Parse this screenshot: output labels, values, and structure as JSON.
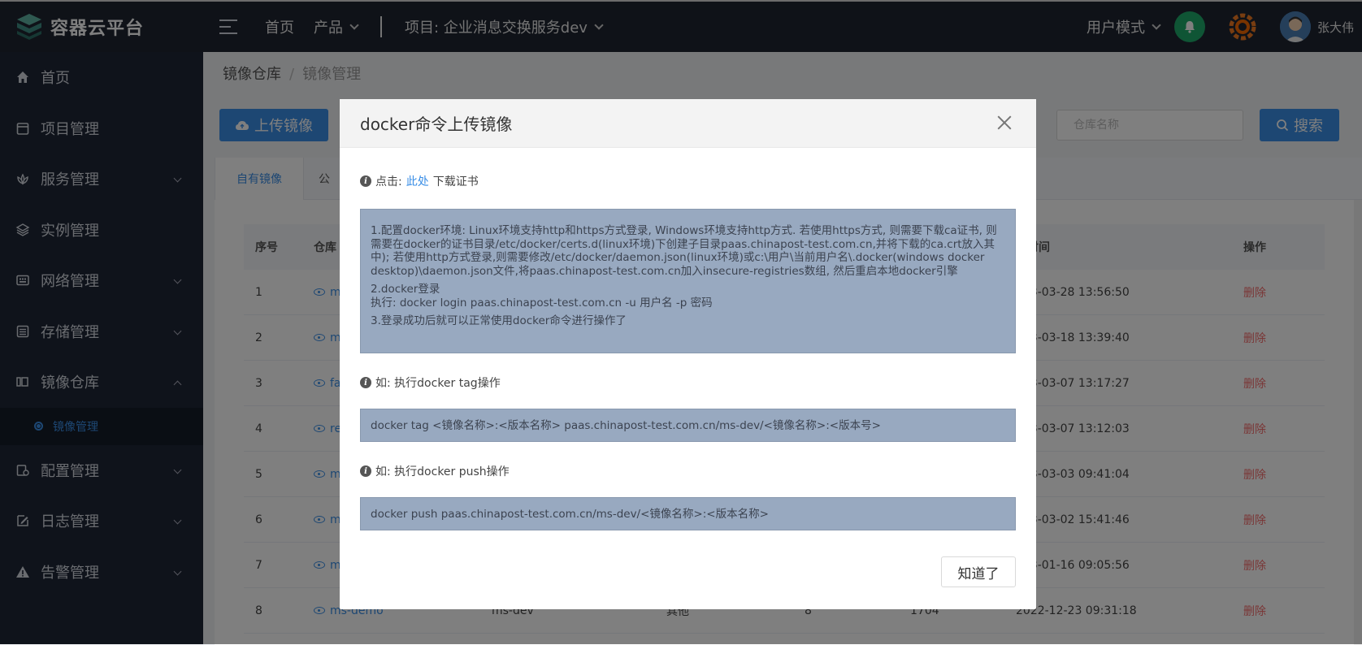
{
  "app": {
    "name": "容器云平台"
  },
  "topnav": {
    "home": "首页",
    "product": "产品",
    "project": "项目: 企业消息交换服务dev",
    "mode": "用户模式",
    "user": "张大伟"
  },
  "sidebar": {
    "items": [
      {
        "label": "首页"
      },
      {
        "label": "项目管理"
      },
      {
        "label": "服务管理"
      },
      {
        "label": "实例管理"
      },
      {
        "label": "网络管理"
      },
      {
        "label": "存储管理"
      },
      {
        "label": "镜像仓库"
      },
      {
        "label": "配置管理"
      },
      {
        "label": "日志管理"
      },
      {
        "label": "告警管理"
      }
    ],
    "sub_active": "镜像管理"
  },
  "breadcrumb": {
    "parent": "镜像仓库",
    "current": "镜像管理"
  },
  "toolbar": {
    "upload_label": "上传镜像",
    "repo_placeholder": "仓库名称",
    "search_label": "搜索"
  },
  "tabs": [
    {
      "label": "自有镜像"
    },
    {
      "label": "公"
    }
  ],
  "table": {
    "headers": [
      "序号",
      "仓库",
      "新时间",
      "操作"
    ],
    "rows": [
      {
        "idx": "1",
        "repo": "m",
        "time": "023-03-28 13:56:50",
        "op": "删除"
      },
      {
        "idx": "2",
        "repo": "m",
        "time": "023-03-18 13:39:40",
        "op": "删除"
      },
      {
        "idx": "3",
        "repo": "fa",
        "time": "023-03-07 13:17:27",
        "op": "删除"
      },
      {
        "idx": "4",
        "repo": "re",
        "time": "023-03-07 13:12:03",
        "op": "删除"
      },
      {
        "idx": "5",
        "repo": "m",
        "time": "023-03-03 09:41:04",
        "op": "删除"
      },
      {
        "idx": "6",
        "repo": "m",
        "time": "023-03-02 15:41:46",
        "op": "删除"
      },
      {
        "idx": "7",
        "repo": "m",
        "time": "023-01-16 09:05:56",
        "op": "删除"
      },
      {
        "idx": "8",
        "repo": "ms-demo",
        "proj": "ms-dev",
        "type": "其他",
        "count": "8",
        "downloads": "1704",
        "time": "2022-12-23 09:31:18",
        "op": "删除"
      }
    ]
  },
  "modal": {
    "title": "docker命令上传镜像",
    "cert_prefix": "点击:",
    "cert_link": "此处",
    "cert_suffix": "下载证书",
    "step1": "1.配置docker环境: Linux环境支持http和https方式登录, Windows环境支持http方式. 若使用https方式, 则需要下载ca证书, 则需要在docker的证书目录/etc/docker/certs.d(linux环境)下创建子目录paas.chinapost-test.com.cn,并将下载的ca.crt放入其中); 若使用http方式登录,则需要修改/etc/docker/daemon.json(linux环境)或c:\\用户\\当前用户名\\.docker(windows docker desktop)\\daemon.json文件,将paas.chinapost-test.com.cn加入insecure-registries数组, 然后重启本地docker引擎",
    "step2_title": "2.docker登录",
    "step2_cmd": "执行:  docker login paas.chinapost-test.com.cn -u 用户名 -p 密码",
    "step3": "3.登录成功后就可以正常使用docker命令进行操作了",
    "tag_hint": "如: 执行docker tag操作",
    "tag_cmd": "docker tag <镜像名称>:<版本名称> paas.chinapost-test.com.cn/ms-dev/<镜像名称>:<版本号>",
    "push_hint": "如: 执行docker push操作",
    "push_cmd": "docker push paas.chinapost-test.com.cn/ms-dev/<镜像名称>:<版本名称>",
    "ok_label": "知道了"
  }
}
